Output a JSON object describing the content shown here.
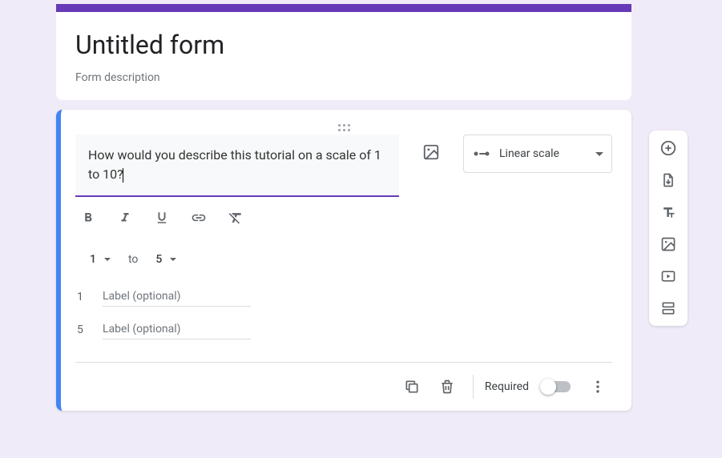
{
  "header": {
    "title": "Untitled form",
    "description": "Form description"
  },
  "question": {
    "text": "How would you describe this tutorial on a scale of 1 to 10?",
    "type_label": "Linear scale",
    "scale": {
      "from": "1",
      "to_word": "to",
      "to": "5",
      "label_low_idx": "1",
      "label_low_placeholder": "Label (optional)",
      "label_high_idx": "5",
      "label_high_placeholder": "Label (optional)"
    }
  },
  "footer": {
    "required_label": "Required"
  }
}
